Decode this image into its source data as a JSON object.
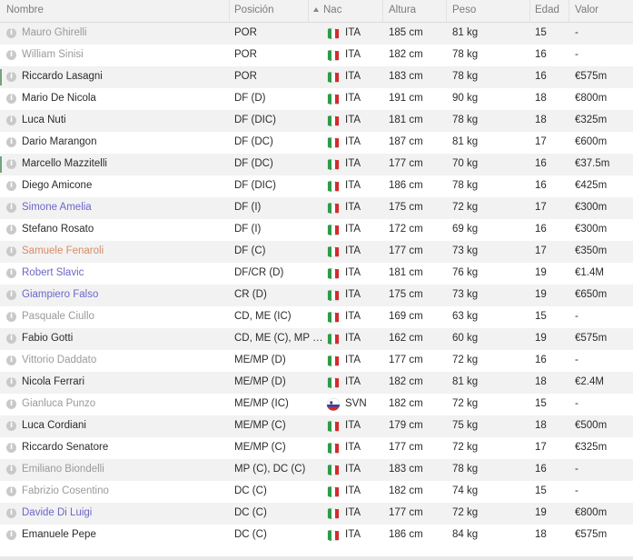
{
  "headers": {
    "nombre": "Nombre",
    "posicion": "Posición",
    "nac": "Nac",
    "altura": "Altura",
    "peso": "Peso",
    "edad": "Edad",
    "valor": "Valor"
  },
  "colors": {
    "muted": "#9a9a9a",
    "loan_blue": "#6a67c9",
    "orange": "#d98a64",
    "flag_green": "#2f9a48",
    "flag_red": "#d52b2b"
  },
  "players": [
    {
      "name": "Mauro Ghirelli",
      "name_style": "muted",
      "position": "POR",
      "nat": "ITA",
      "flag": "italy-flag-icon",
      "height": "185 cm",
      "weight": "81 kg",
      "age": "15",
      "value": "-",
      "marker": false
    },
    {
      "name": "William Sinisi",
      "name_style": "muted",
      "position": "POR",
      "nat": "ITA",
      "flag": "italy-flag-icon",
      "height": "182 cm",
      "weight": "78 kg",
      "age": "16",
      "value": "-",
      "marker": false
    },
    {
      "name": "Riccardo Lasagni",
      "name_style": "normal",
      "position": "POR",
      "nat": "ITA",
      "flag": "italy-flag-icon",
      "height": "183 cm",
      "weight": "78 kg",
      "age": "16",
      "value": "€575m",
      "marker": true
    },
    {
      "name": "Mario De Nicola",
      "name_style": "normal",
      "position": "DF (D)",
      "nat": "ITA",
      "flag": "italy-flag-icon",
      "height": "191 cm",
      "weight": "90 kg",
      "age": "18",
      "value": "€800m",
      "marker": false
    },
    {
      "name": "Luca Nuti",
      "name_style": "normal",
      "position": "DF (DIC)",
      "nat": "ITA",
      "flag": "italy-flag-icon",
      "height": "181 cm",
      "weight": "78 kg",
      "age": "18",
      "value": "€325m",
      "marker": false
    },
    {
      "name": "Dario Marangon",
      "name_style": "normal",
      "position": "DF (DC)",
      "nat": "ITA",
      "flag": "italy-flag-icon",
      "height": "187 cm",
      "weight": "81 kg",
      "age": "17",
      "value": "€600m",
      "marker": false
    },
    {
      "name": "Marcello Mazzitelli",
      "name_style": "normal",
      "position": "DF (DC)",
      "nat": "ITA",
      "flag": "italy-flag-icon",
      "height": "177 cm",
      "weight": "70 kg",
      "age": "16",
      "value": "€37.5m",
      "marker": true
    },
    {
      "name": "Diego Amicone",
      "name_style": "normal",
      "position": "DF (DIC)",
      "nat": "ITA",
      "flag": "italy-flag-icon",
      "height": "186 cm",
      "weight": "78 kg",
      "age": "16",
      "value": "€425m",
      "marker": false
    },
    {
      "name": "Simone Amelia",
      "name_style": "blue",
      "position": "DF (I)",
      "nat": "ITA",
      "flag": "italy-flag-icon",
      "height": "175 cm",
      "weight": "72 kg",
      "age": "17",
      "value": "€300m",
      "marker": false
    },
    {
      "name": "Stefano Rosato",
      "name_style": "normal",
      "position": "DF (I)",
      "nat": "ITA",
      "flag": "italy-flag-icon",
      "height": "172 cm",
      "weight": "69 kg",
      "age": "16",
      "value": "€300m",
      "marker": false
    },
    {
      "name": "Samuele Fenaroli",
      "name_style": "orange",
      "position": "DF (C)",
      "nat": "ITA",
      "flag": "italy-flag-icon",
      "height": "177 cm",
      "weight": "73 kg",
      "age": "17",
      "value": "€350m",
      "marker": false
    },
    {
      "name": "Robert Slavic",
      "name_style": "blue",
      "position": "DF/CR (D)",
      "nat": "ITA",
      "flag": "italy-flag-icon",
      "height": "181 cm",
      "weight": "76 kg",
      "age": "19",
      "value": "€1.4M",
      "marker": false
    },
    {
      "name": "Giampiero Falso",
      "name_style": "blue",
      "position": "CR (D)",
      "nat": "ITA",
      "flag": "italy-flag-icon",
      "height": "175 cm",
      "weight": "73 kg",
      "age": "19",
      "value": "€650m",
      "marker": false
    },
    {
      "name": "Pasquale Ciullo",
      "name_style": "muted",
      "position": "CD, ME (IC)",
      "nat": "ITA",
      "flag": "italy-flag-icon",
      "height": "169 cm",
      "weight": "63 kg",
      "age": "15",
      "value": "-",
      "marker": false
    },
    {
      "name": "Fabio Gotti",
      "name_style": "normal",
      "position": "CD, ME (C), MP (C)",
      "nat": "ITA",
      "flag": "italy-flag-icon",
      "height": "162 cm",
      "weight": "60 kg",
      "age": "19",
      "value": "€575m",
      "marker": false
    },
    {
      "name": "Vittorio Daddato",
      "name_style": "muted",
      "position": "ME/MP (D)",
      "nat": "ITA",
      "flag": "italy-flag-icon",
      "height": "177 cm",
      "weight": "72 kg",
      "age": "16",
      "value": "-",
      "marker": false
    },
    {
      "name": "Nicola Ferrari",
      "name_style": "normal",
      "position": "ME/MP (D)",
      "nat": "ITA",
      "flag": "italy-flag-icon",
      "height": "182 cm",
      "weight": "81 kg",
      "age": "18",
      "value": "€2.4M",
      "marker": false
    },
    {
      "name": "Gianluca Punzo",
      "name_style": "muted",
      "position": "ME/MP (IC)",
      "nat": "SVN",
      "flag": "slovenia-flag-icon",
      "height": "182 cm",
      "weight": "72 kg",
      "age": "15",
      "value": "-",
      "marker": false
    },
    {
      "name": "Luca Cordiani",
      "name_style": "normal",
      "position": "ME/MP (C)",
      "nat": "ITA",
      "flag": "italy-flag-icon",
      "height": "179 cm",
      "weight": "75 kg",
      "age": "18",
      "value": "€500m",
      "marker": false
    },
    {
      "name": "Riccardo Senatore",
      "name_style": "normal",
      "position": "ME/MP (C)",
      "nat": "ITA",
      "flag": "italy-flag-icon",
      "height": "177 cm",
      "weight": "72 kg",
      "age": "17",
      "value": "€325m",
      "marker": false
    },
    {
      "name": "Emiliano Biondelli",
      "name_style": "muted",
      "position": "MP (C), DC (C)",
      "nat": "ITA",
      "flag": "italy-flag-icon",
      "height": "183 cm",
      "weight": "78 kg",
      "age": "16",
      "value": "-",
      "marker": false
    },
    {
      "name": "Fabrizio Cosentino",
      "name_style": "muted",
      "position": "DC (C)",
      "nat": "ITA",
      "flag": "italy-flag-icon",
      "height": "182 cm",
      "weight": "74 kg",
      "age": "15",
      "value": "-",
      "marker": false
    },
    {
      "name": "Davide Di Luigi",
      "name_style": "blue",
      "position": "DC (C)",
      "nat": "ITA",
      "flag": "italy-flag-icon",
      "height": "177 cm",
      "weight": "72 kg",
      "age": "19",
      "value": "€800m",
      "marker": false
    },
    {
      "name": "Emanuele Pepe",
      "name_style": "normal",
      "position": "DC (C)",
      "nat": "ITA",
      "flag": "italy-flag-icon",
      "height": "186 cm",
      "weight": "84 kg",
      "age": "18",
      "value": "€575m",
      "marker": false
    }
  ]
}
